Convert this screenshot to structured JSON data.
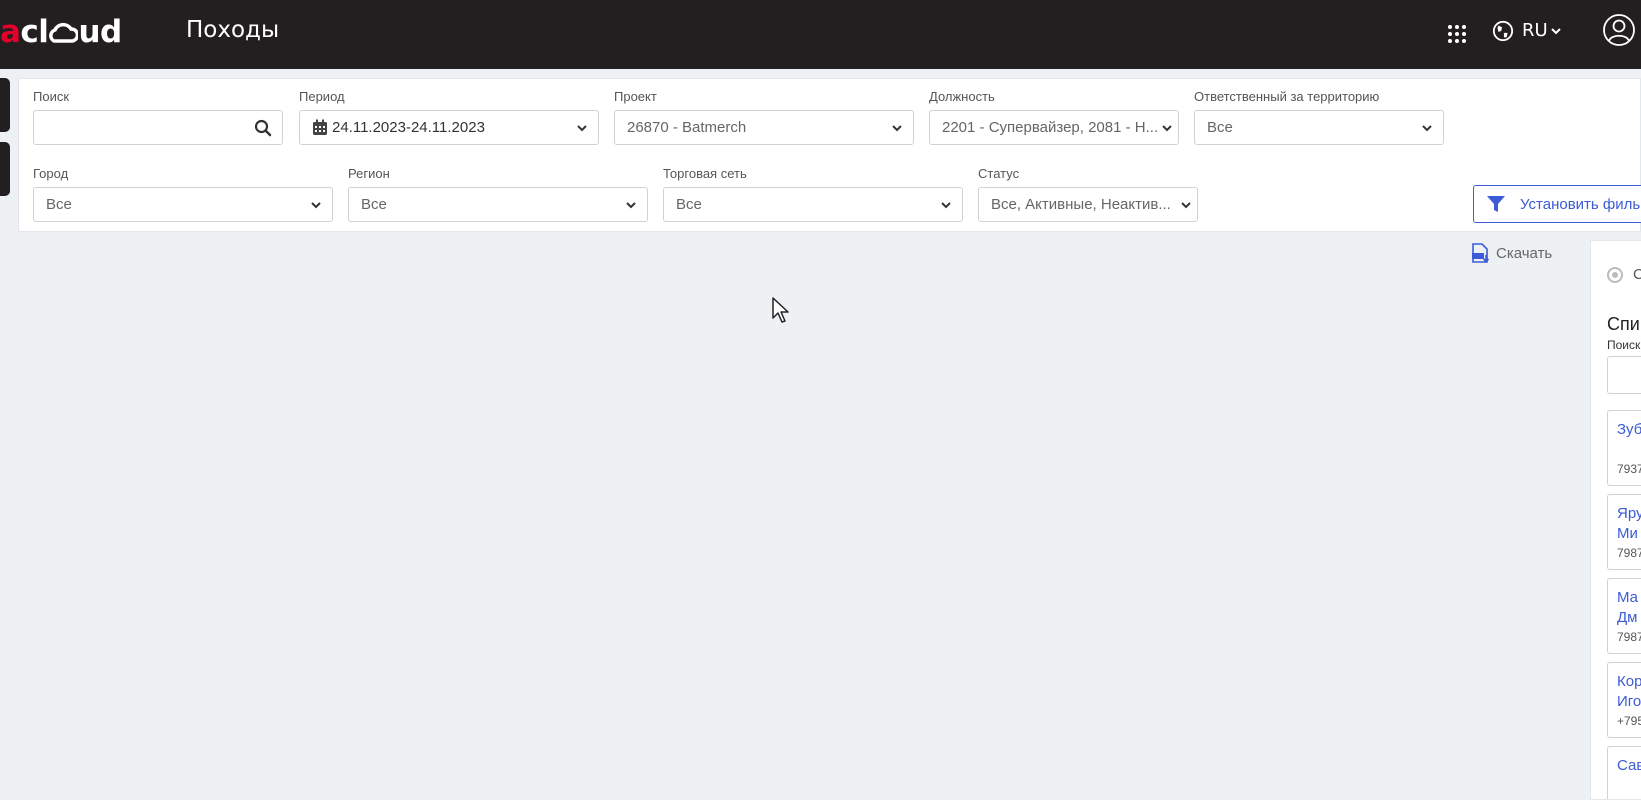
{
  "header": {
    "logo_prefix": "a",
    "logo_text": "cl",
    "logo_suffix": "ud",
    "page_title": "Походы",
    "language": "RU",
    "icons": {
      "apps": "apps-grid-icon",
      "globe": "globe-icon",
      "chevron": "chevron-down-icon",
      "user": "user-circle-icon"
    }
  },
  "filters": {
    "search": {
      "label": "Поиск",
      "value": ""
    },
    "period": {
      "label": "Период",
      "value": "24.11.2023-24.11.2023"
    },
    "project": {
      "label": "Проект",
      "value": "26870 - Batmerch"
    },
    "position": {
      "label": "Должность",
      "value": "2201 - Супервайзер, 2081 - Н..."
    },
    "territory_owner": {
      "label": "Ответственный за территорию",
      "value": "Все"
    },
    "city": {
      "label": "Город",
      "value": "Все"
    },
    "region": {
      "label": "Регион",
      "value": "Все"
    },
    "retail_chain": {
      "label": "Торговая сеть",
      "value": "Все"
    },
    "status": {
      "label": "Статус",
      "value": "Все, Активные, Неактив..."
    },
    "apply_label": "Установить филь"
  },
  "toolbar": {
    "download_label": "Скачать"
  },
  "right_panel": {
    "radio_label": "С",
    "title": "Спи",
    "search_label": "Поиск",
    "cards": [
      {
        "name_lines": [
          "Зуб"
        ],
        "phone": "7937"
      },
      {
        "name_lines": [
          "Яру",
          "Ми"
        ],
        "phone": "7987"
      },
      {
        "name_lines": [
          "Ма",
          "Дм"
        ],
        "phone": "7987"
      },
      {
        "name_lines": [
          "Кор",
          "Иго"
        ],
        "phone": "+795"
      },
      {
        "name_lines": [
          "Сав"
        ],
        "phone": ""
      }
    ]
  },
  "colors": {
    "topbar": "#231f20",
    "accent_blue": "#3c5bd6",
    "logo_red": "#e4002b",
    "background": "#eef1f4"
  }
}
